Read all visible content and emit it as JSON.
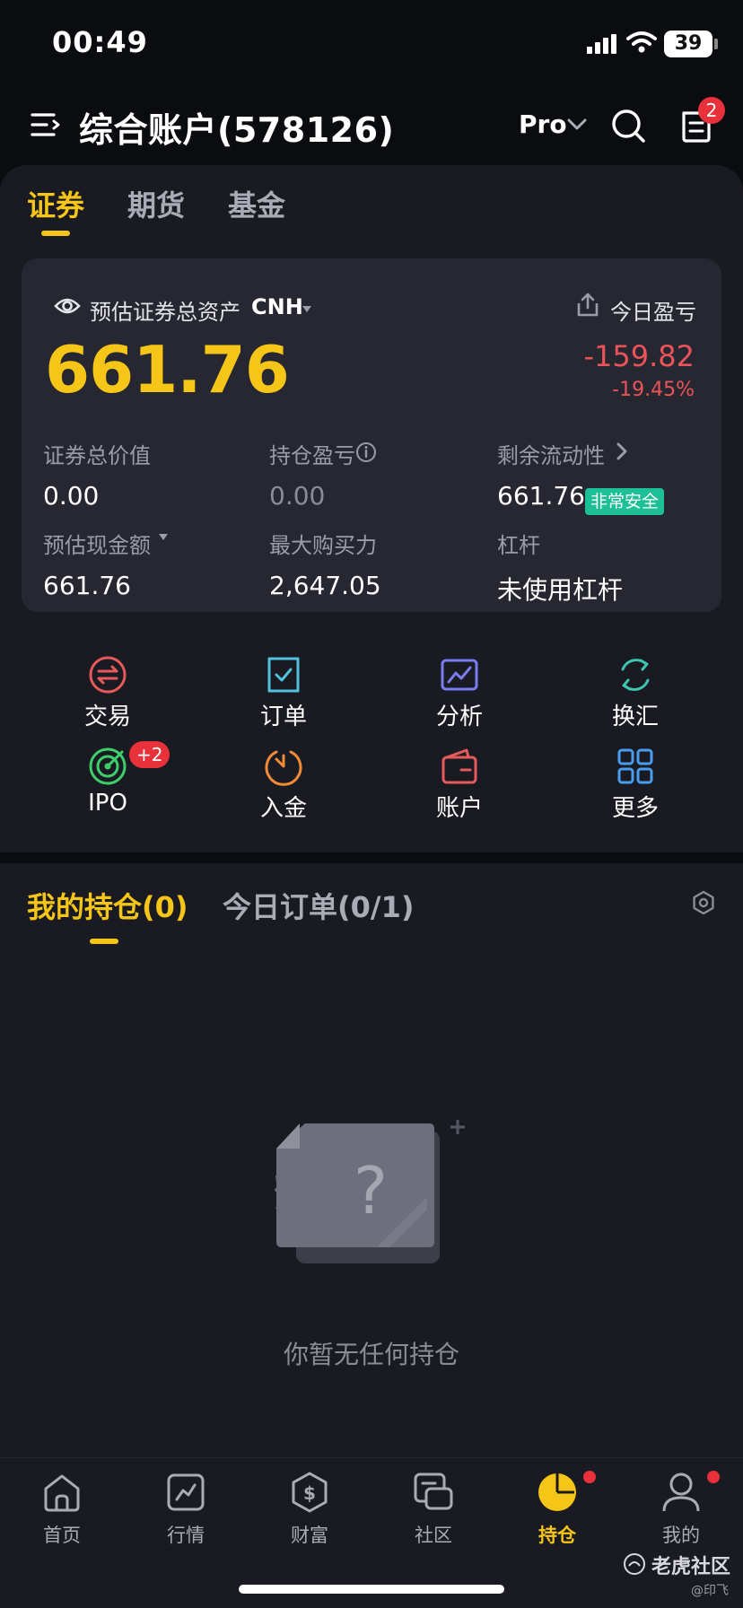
{
  "status_bar": {
    "time": "00:49",
    "battery": "39"
  },
  "header": {
    "title": "综合账户(578126)",
    "pro_label": "Pro",
    "message_badge": "2"
  },
  "tabs": [
    "证券",
    "期货",
    "基金"
  ],
  "asset_card": {
    "label": "预估证券总资产",
    "currency": "CNH",
    "pnl_label": "今日盈亏",
    "total_assets": "661.76",
    "pnl_value": "-159.82",
    "pnl_pct": "-19.45%",
    "stats": [
      {
        "label": "证券总价值",
        "value": "0.00"
      },
      {
        "label": "持仓盈亏",
        "value": "0.00"
      },
      {
        "label": "剩余流动性",
        "value": "661.76",
        "badge": "非常安全"
      },
      {
        "label": "预估现金额",
        "value": "661.76"
      },
      {
        "label": "最大购买力",
        "value": "2,647.05"
      },
      {
        "label": "杠杆",
        "value": "未使用杠杆"
      }
    ]
  },
  "actions": [
    {
      "label": "交易",
      "icon": "exchange-icon"
    },
    {
      "label": "订单",
      "icon": "order-check-icon"
    },
    {
      "label": "分析",
      "icon": "analysis-chart-icon"
    },
    {
      "label": "换汇",
      "icon": "currency-swap-icon"
    },
    {
      "label": "IPO",
      "icon": "ipo-target-icon",
      "badge": "+2"
    },
    {
      "label": "入金",
      "icon": "deposit-icon"
    },
    {
      "label": "账户",
      "icon": "wallet-icon"
    },
    {
      "label": "更多",
      "icon": "grid-more-icon"
    }
  ],
  "holdings": {
    "tab_positions": "我的持仓(0)",
    "tab_orders": "今日订单(0/1)",
    "empty_text": "你暂无任何持仓"
  },
  "bottom_nav": [
    {
      "label": "首页"
    },
    {
      "label": "行情"
    },
    {
      "label": "财富"
    },
    {
      "label": "社区"
    },
    {
      "label": "持仓"
    },
    {
      "label": "我的"
    }
  ],
  "watermark": {
    "brand": "老虎社区",
    "user": "@印飞"
  },
  "colors": {
    "accent": "#f5c518",
    "loss": "#ea5458",
    "safe": "#1dbf96",
    "badge": "#e8313b"
  }
}
